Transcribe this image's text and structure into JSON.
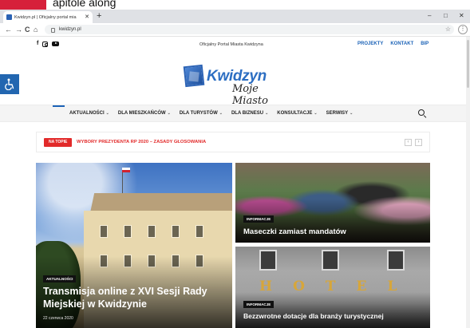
{
  "caption": {
    "text": "apitole along"
  },
  "browser": {
    "tab_title": "Kwidzyn.pl | Oficjalny portal mia",
    "new_tab": "+",
    "minimize": "–",
    "maximize": "□",
    "close": "✕",
    "url": "kwidzyn.pl",
    "back": "←",
    "forward": "→",
    "reload": "C",
    "home": "⌂",
    "bookmark": "☆",
    "menu": "⋮"
  },
  "topbar": {
    "social_facebook": "f",
    "portal_name": "Oficjalny Portal Miasta Kwidzyna",
    "links": [
      "PROJEKTY",
      "KONTAKT",
      "BIP"
    ]
  },
  "logo": {
    "name": "Kwidzyn",
    "tagline": "Moje Miasto"
  },
  "nav": {
    "items": [
      "AKTUALNOŚCI",
      "DLA MIESZKAŃCÓW",
      "DLA TURYSTÓW",
      "DLA BIZNESU",
      "KONSULTACJE",
      "SERWISY"
    ],
    "chevron": "⌄"
  },
  "ticker": {
    "badge": "NA TOPIE",
    "text": "WYBORY PREZYDENTA RP 2020 – ZASADY GŁOSOWANIA",
    "prev": "‹",
    "next": "›"
  },
  "articles": {
    "main": {
      "tag": "AKTUALNOŚCI",
      "title": "Transmisja online z XVI Sesji Rady Miejskiej w Kwidzynie",
      "date": "22 czerwca 2020"
    },
    "top": {
      "tag": "INFORMACJE",
      "title": "Maseczki zamiast mandatów"
    },
    "bottom": {
      "tag": "INFORMACJE",
      "title": "Bezzwrotne dotacje dla branży turystycznej",
      "sign_letters": [
        "H",
        "O",
        "T",
        "E",
        "L"
      ]
    }
  },
  "colors": {
    "accent_blue": "#1c63b7",
    "hot_red": "#e22a2a",
    "access_blue": "#2266b0"
  },
  "icons": {
    "accessibility": "wheelchair-icon",
    "search": "search-icon",
    "instagram": "instagram-icon",
    "youtube": "youtube-icon"
  }
}
